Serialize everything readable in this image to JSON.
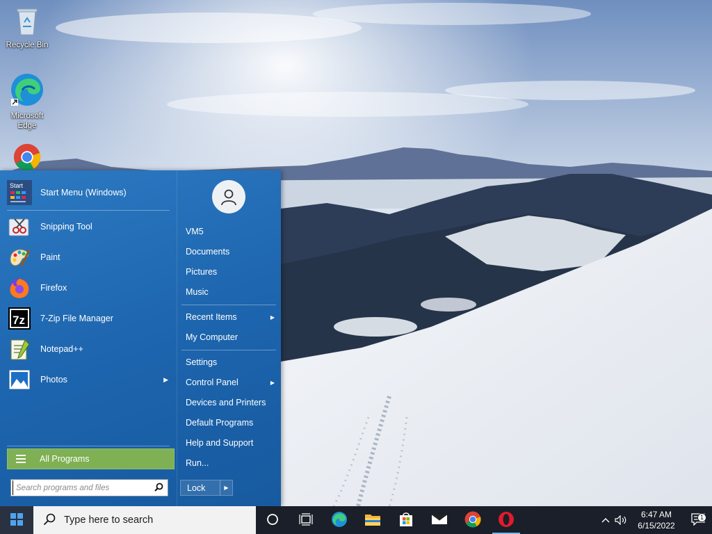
{
  "desktop": {
    "icons": [
      {
        "label": "Recycle Bin",
        "icon": "recycle-bin-icon"
      },
      {
        "label": "Microsoft Edge",
        "icon": "edge-icon"
      },
      {
        "label": "",
        "icon": "chrome-icon"
      }
    ]
  },
  "start_menu": {
    "pinned": [
      {
        "label": "Start Menu (Windows)",
        "icon": "start-menu-app-icon",
        "icon_text": "Start"
      },
      {
        "label": "Snipping Tool",
        "icon": "snipping-tool-icon"
      },
      {
        "label": "Paint",
        "icon": "paint-icon"
      },
      {
        "label": "Firefox",
        "icon": "firefox-icon"
      },
      {
        "label": "7-Zip File Manager",
        "icon": "7zip-icon",
        "icon_text": "7z"
      },
      {
        "label": "Notepad++",
        "icon": "notepadpp-icon"
      },
      {
        "label": "Photos",
        "icon": "photos-icon",
        "has_submenu": true
      }
    ],
    "all_programs_label": "All Programs",
    "search_placeholder": "Search programs and files",
    "user_avatar": "user-avatar-icon",
    "right_items": [
      {
        "label": "VM5"
      },
      {
        "label": "Documents"
      },
      {
        "label": "Pictures"
      },
      {
        "label": "Music"
      },
      {
        "label": "Recent Items",
        "has_submenu": true
      },
      {
        "label": "My Computer"
      },
      {
        "label": "Settings"
      },
      {
        "label": "Control Panel",
        "has_submenu": true
      },
      {
        "label": "Devices and Printers"
      },
      {
        "label": "Default Programs"
      },
      {
        "label": "Help and Support"
      },
      {
        "label": "Run..."
      }
    ],
    "lock_label": "Lock",
    "colors": {
      "menu_bg": "#1f68b0",
      "all_programs_bg": "#7fb054"
    }
  },
  "taskbar": {
    "search_placeholder": "Type here to search",
    "apps": [
      {
        "name": "cortana-icon"
      },
      {
        "name": "task-view-icon"
      },
      {
        "name": "edge-icon"
      },
      {
        "name": "file-explorer-icon"
      },
      {
        "name": "microsoft-store-icon"
      },
      {
        "name": "mail-icon"
      },
      {
        "name": "chrome-icon"
      },
      {
        "name": "opera-icon",
        "active": true
      }
    ],
    "tray": {
      "time": "6:47 AM",
      "date": "6/15/2022",
      "notification_count": "1"
    }
  }
}
